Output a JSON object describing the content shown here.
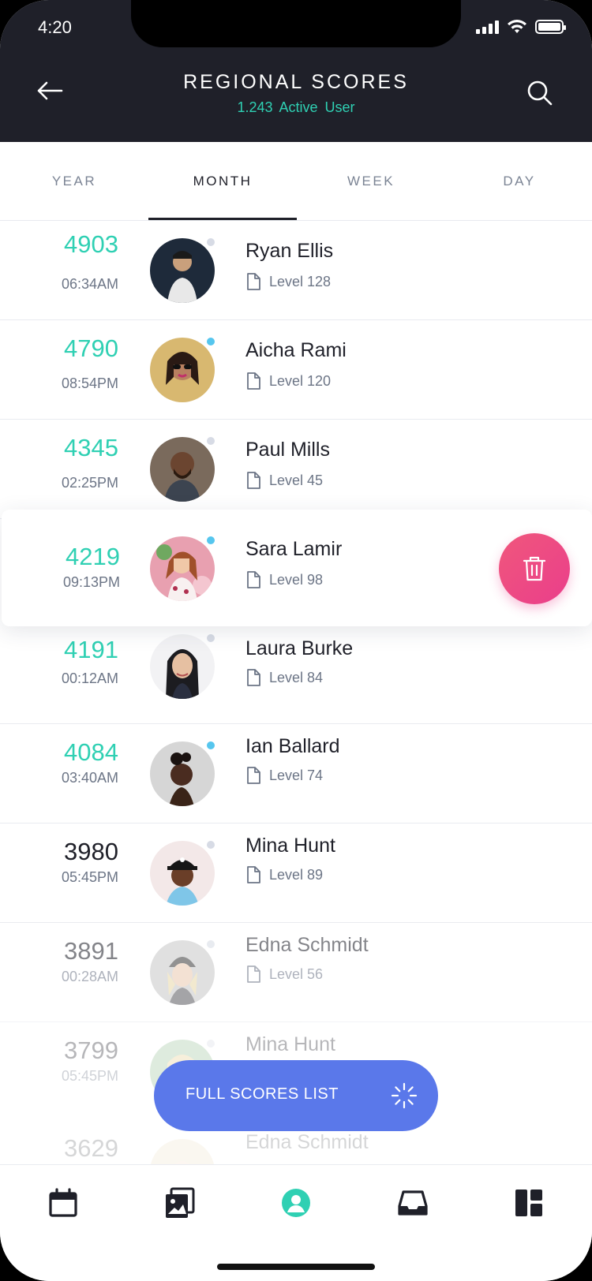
{
  "status_bar": {
    "time": "4:20"
  },
  "header": {
    "title": "REGIONAL SCORES",
    "subtitle": "1.243 Active User",
    "back_icon": "arrow-left-icon",
    "search_icon": "search-icon"
  },
  "tabs": [
    {
      "label": "YEAR",
      "active": false
    },
    {
      "label": "MONTH",
      "active": true
    },
    {
      "label": "WEEK",
      "active": false
    },
    {
      "label": "DAY",
      "active": false
    }
  ],
  "rows": [
    {
      "score": "4903",
      "time": "06:34AM",
      "name": "Ryan Ellis",
      "level": "Level 128",
      "online": false
    },
    {
      "score": "4790",
      "time": "08:54PM",
      "name": "Aicha Rami",
      "level": "Level 120",
      "online": true
    },
    {
      "score": "4345",
      "time": "02:25PM",
      "name": "Paul Mills",
      "level": "Level 45",
      "online": false
    },
    {
      "score": "4219",
      "time": "09:13PM",
      "name": "Sara Lamir",
      "level": "Level 98",
      "online": true
    },
    {
      "score": "4191",
      "time": "00:12AM",
      "name": "Laura Burke",
      "level": "Level 84",
      "online": false
    },
    {
      "score": "4084",
      "time": "03:40AM",
      "name": "Ian Ballard",
      "level": "Level 74",
      "online": true
    },
    {
      "score": "3980",
      "time": "05:45PM",
      "name": "Mina Hunt",
      "level": "Level 89",
      "online": false
    },
    {
      "score": "3891",
      "time": "00:28AM",
      "name": "Edna Schmidt",
      "level": "Level 56",
      "online": false
    },
    {
      "score": "3799",
      "time": "05:45PM",
      "name": "Mina Hunt",
      "level": "",
      "online": false
    },
    {
      "score": "3629",
      "time": "",
      "name": "Edna Schmidt",
      "level": "",
      "online": false
    }
  ],
  "delete_icon": "trash-icon",
  "fab": {
    "label": "FULL SCORES LIST",
    "icon": "loading-spinner-icon"
  },
  "bottom_nav": [
    {
      "icon": "calendar-icon"
    },
    {
      "icon": "gallery-icon"
    },
    {
      "icon": "profile-icon",
      "active": true
    },
    {
      "icon": "inbox-icon"
    },
    {
      "icon": "dashboard-icon"
    }
  ],
  "colors": {
    "header_bg": "#1f2029",
    "accent_teal": "#2fd0b3",
    "fab_blue": "#5a78ea",
    "delete_pink": "#ee4d85",
    "online_dot": "#56c6ee",
    "offline_dot": "#d7dbe5"
  }
}
